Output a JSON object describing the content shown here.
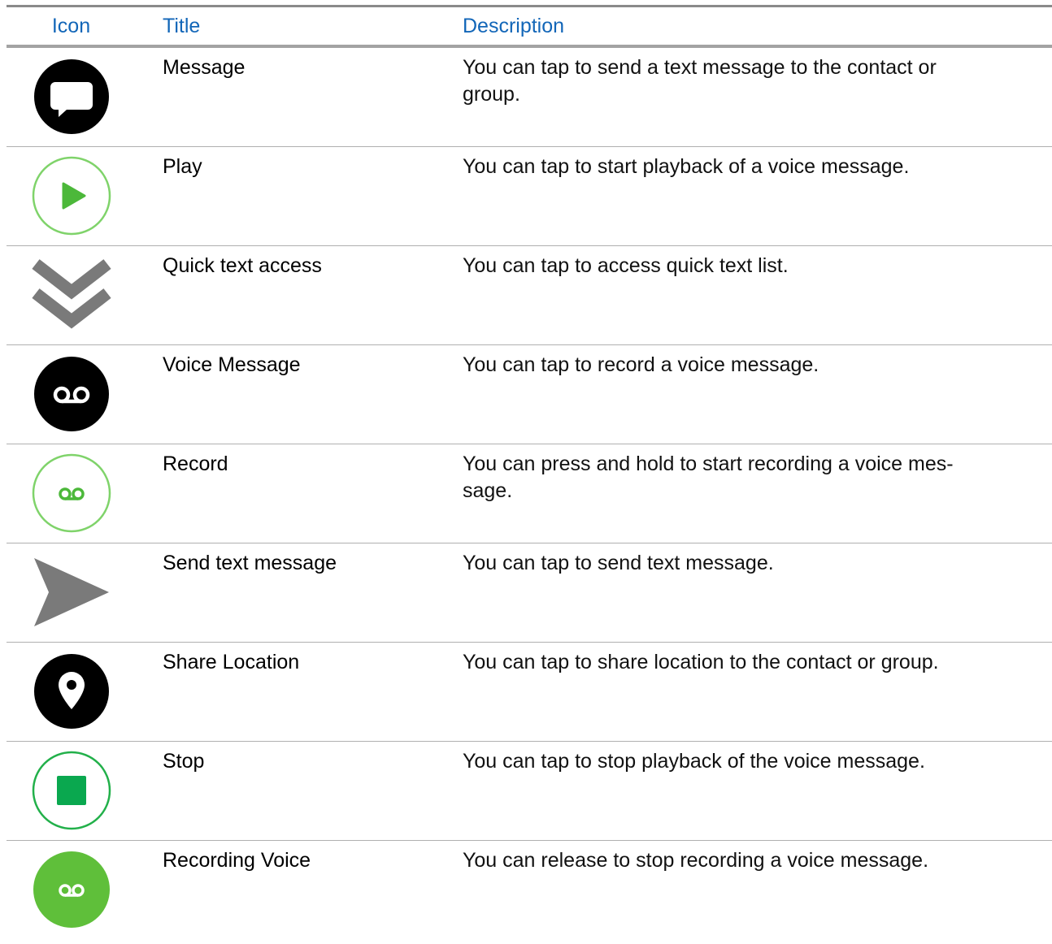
{
  "header": {
    "icon": "Icon",
    "title": "Title",
    "description": "Description"
  },
  "rows": [
    {
      "icon": "message-icon",
      "title": "Message",
      "description": "You can tap to send a text message to the contact or group."
    },
    {
      "icon": "play-icon",
      "title": "Play",
      "description": "You can tap to start playback of a voice message."
    },
    {
      "icon": "quick-text-chevron-icon",
      "title": "Quick text access",
      "description": "You can tap to access quick text list."
    },
    {
      "icon": "voicemail-icon",
      "title": "Voice Message",
      "description": "You can tap to record a voice message."
    },
    {
      "icon": "record-icon",
      "title": "Record",
      "description": "You can press and hold to start recording a voice mes-sage."
    },
    {
      "icon": "send-arrow-icon",
      "title": "Send text message",
      "description": "You can tap to send text message."
    },
    {
      "icon": "location-pin-icon",
      "title": "Share Location",
      "description": "You can tap to share location to the contact or group."
    },
    {
      "icon": "stop-icon",
      "title": "Stop",
      "description": "You can tap to stop playback of the voice message."
    },
    {
      "icon": "recording-voice-icon",
      "title": "Recording Voice",
      "description": "You can release to stop recording a voice message."
    }
  ],
  "colors": {
    "header_text": "#1266b8",
    "green": "#5fbf3a",
    "green_dark": "#0aa84f",
    "gray_icon": "#7a7a7a"
  }
}
